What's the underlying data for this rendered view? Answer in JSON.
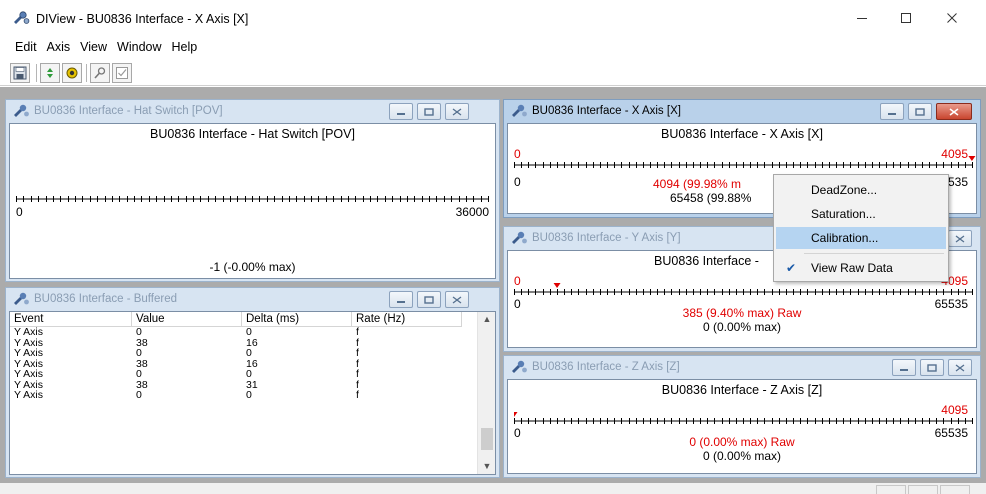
{
  "app": {
    "title": "DIView - BU0836 Interface - X Axis [X]",
    "icon": "wrench-joystick-icon",
    "controls": [
      "minimize",
      "maximize",
      "close"
    ]
  },
  "menu": [
    "Edit",
    "Axis",
    "View",
    "Window",
    "Help"
  ],
  "toolbar": [
    "save-icon",
    "refresh-icon",
    "settings-icon",
    "inspect-icon",
    "checklist-icon"
  ],
  "windows": {
    "hat": {
      "caption": "BU0836 Interface - Hat Switch [POV]",
      "heading": "BU0836 Interface - Hat Switch [POV]",
      "min_label": "0",
      "max_label": "36000",
      "readout": "-1 (-0.00% max)"
    },
    "buffered": {
      "caption": "BU0836 Interface - Buffered",
      "columns": [
        "Event",
        "Value",
        "Delta (ms)",
        "Rate (Hz)"
      ],
      "rows": [
        [
          "Y Axis",
          "0",
          "0",
          "f"
        ],
        [
          "Y Axis",
          "38",
          "16",
          "f"
        ],
        [
          "Y Axis",
          "0",
          "0",
          "f"
        ],
        [
          "Y Axis",
          "38",
          "16",
          "f"
        ],
        [
          "Y Axis",
          "0",
          "0",
          "f"
        ],
        [
          "Y Axis",
          "38",
          "31",
          "f"
        ],
        [
          "Y Axis",
          "0",
          "0",
          "f"
        ]
      ]
    },
    "x": {
      "caption": "BU0836 Interface - X Axis [X]",
      "heading": "BU0836 Interface - X Axis [X]",
      "cal_min": "0",
      "cal_max": "4095",
      "raw_min": "0",
      "raw_max": "65535",
      "readout_cal": "4094 (99.98% m",
      "readout_raw": "65458 (99.88%",
      "position_fraction": 0.9998
    },
    "y": {
      "caption": "BU0836 Interface - Y Axis [Y]",
      "heading": "BU0836 Interface -",
      "cal_min": "0",
      "cal_max": "4095",
      "raw_min": "0",
      "raw_max": "65535",
      "readout_cal": "385 (9.40% max)  Raw",
      "readout_raw": "0 (0.00% max)",
      "position_fraction": 0.094
    },
    "z": {
      "caption": "BU0836 Interface - Z Axis [Z]",
      "heading": "BU0836 Interface - Z Axis [Z]",
      "cal_min": "",
      "cal_max": "4095",
      "raw_min": "0",
      "raw_max": "65535",
      "readout_cal": "0 (0.00% max)  Raw",
      "readout_raw": "0 (0.00% max)",
      "position_fraction": 0.0
    }
  },
  "context_menu": {
    "items": [
      "DeadZone...",
      "Saturation...",
      "Calibration...",
      "View Raw Data"
    ],
    "highlighted": "Calibration...",
    "checked": "View Raw Data"
  },
  "colors": {
    "calibrated_value": "#e00000",
    "active_caption": "#b9d1ea",
    "inactive_caption": "#d7e4f2",
    "mdi_background": "#ababab",
    "menu_highlight": "#b5d4f1"
  }
}
